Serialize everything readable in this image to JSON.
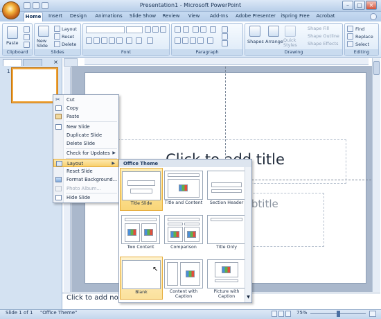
{
  "window": {
    "title": "Presentation1 - Microsoft PowerPoint"
  },
  "tabs": [
    "Home",
    "Insert",
    "Design",
    "Animations",
    "Slide Show",
    "Review",
    "View",
    "Add-Ins",
    "Adobe Presenter",
    "iSpring Free",
    "Acrobat"
  ],
  "ribbon": {
    "clipboard": {
      "label": "Clipboard",
      "paste": "Paste"
    },
    "slides": {
      "label": "Slides",
      "new_slide": "New Slide",
      "layout": "Layout",
      "reset": "Reset",
      "delete": "Delete"
    },
    "font": {
      "label": "Font"
    },
    "paragraph": {
      "label": "Paragraph"
    },
    "drawing": {
      "label": "Drawing",
      "shapes": "Shapes",
      "arrange": "Arrange",
      "quick_styles": "Quick Styles",
      "shape_fill": "Shape Fill",
      "shape_outline": "Shape Outline",
      "shape_effects": "Shape Effects"
    },
    "editing": {
      "label": "Editing",
      "find": "Find",
      "replace": "Replace",
      "select": "Select"
    }
  },
  "slide_pane": {
    "slide_number": "1"
  },
  "slide": {
    "title_placeholder": "Click to add title",
    "subtitle_placeholder": "Click to add subtitle"
  },
  "notes": {
    "placeholder": "Click to add notes"
  },
  "status": {
    "slide": "Slide 1 of 1",
    "theme": "\"Office Theme\"",
    "zoom": "75%"
  },
  "context_menu": {
    "items": [
      {
        "label": "Cut",
        "icon": "scissors-icon"
      },
      {
        "label": "Copy",
        "icon": "copy-icon"
      },
      {
        "label": "Paste",
        "icon": "paste-icon"
      },
      {
        "label": "New Slide",
        "icon": "new-slide-icon"
      },
      {
        "label": "Duplicate Slide",
        "icon": ""
      },
      {
        "label": "Delete Slide",
        "icon": ""
      },
      {
        "label": "Check for Updates",
        "icon": "",
        "submenu": true
      },
      {
        "label": "Layout",
        "icon": "layout-icon",
        "submenu": true,
        "highlighted": true
      },
      {
        "label": "Reset Slide",
        "icon": ""
      },
      {
        "label": "Format Background...",
        "icon": "format-background-icon"
      },
      {
        "label": "Photo Album...",
        "icon": "photo-album-icon",
        "disabled": true
      },
      {
        "label": "Hide Slide",
        "icon": "hide-slide-icon"
      }
    ]
  },
  "layout_gallery": {
    "header": "Office Theme",
    "layouts": [
      "Title Slide",
      "Title and Content",
      "Section Header",
      "Two Content",
      "Comparison",
      "Title Only",
      "Blank",
      "Content with Caption",
      "Picture with Caption"
    ],
    "selected": "Title Slide"
  },
  "colors": {
    "accent": "#f8cf6c",
    "ribbon": "#dce9f7",
    "window": "#b9cfe9"
  }
}
